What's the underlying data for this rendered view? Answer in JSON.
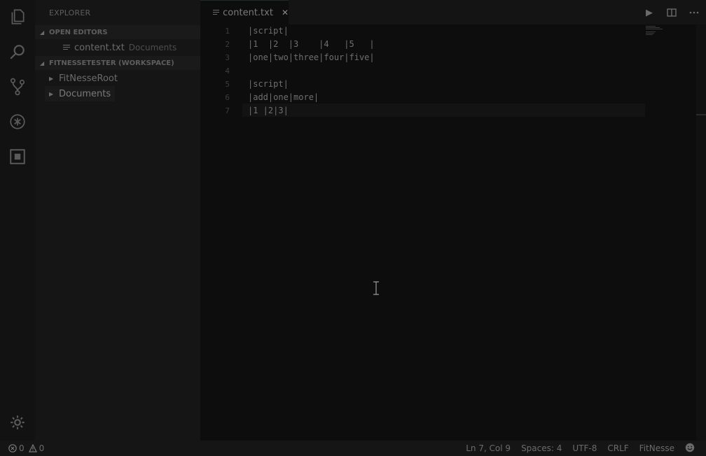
{
  "activity_bar": {
    "items": [
      {
        "name": "explorer",
        "icon": "files-icon"
      },
      {
        "name": "search",
        "icon": "search-icon"
      },
      {
        "name": "source-control",
        "icon": "source-control-icon"
      },
      {
        "name": "debug",
        "icon": "debug-icon"
      },
      {
        "name": "extensions",
        "icon": "extensions-icon"
      }
    ],
    "settings_icon": "gear-icon"
  },
  "sidebar": {
    "title": "EXPLORER",
    "open_editors": {
      "header": "OPEN EDITORS",
      "files": [
        {
          "name": "content.txt",
          "folder": "Documents"
        }
      ]
    },
    "workspace": {
      "header": "FITNESSETESTER (WORKSPACE)",
      "items": [
        {
          "label": "FitNesseRoot"
        },
        {
          "label": "Documents"
        }
      ]
    }
  },
  "editor": {
    "tab": {
      "label": "content.txt",
      "close_glyph": "✕"
    },
    "lines": [
      {
        "num": "1",
        "text": "|script|"
      },
      {
        "num": "2",
        "text": "|1  |2  |3    |4   |5   |"
      },
      {
        "num": "3",
        "text": "|one|two|three|four|five|"
      },
      {
        "num": "4",
        "text": ""
      },
      {
        "num": "5",
        "text": "|script|"
      },
      {
        "num": "6",
        "text": "|add|one|more|"
      },
      {
        "num": "7",
        "text": "|1 |2|3|"
      }
    ]
  },
  "statusbar": {
    "errors": "0",
    "warnings": "0",
    "position": "Ln 7, Col 9",
    "spaces": "Spaces: 4",
    "encoding": "UTF-8",
    "eol": "CRLF",
    "language": "FitNesse"
  },
  "colors": {
    "background": "#101010",
    "sidebar": "#151515",
    "editor": "#0d0d0d",
    "text": "#6f6f6f"
  }
}
